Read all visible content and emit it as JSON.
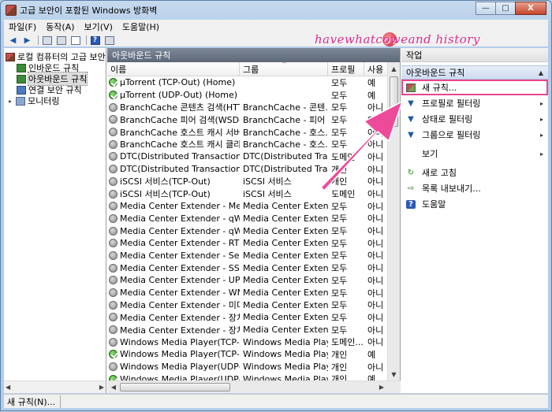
{
  "window": {
    "title": "고급 보안이 포함된 Windows 방화벽",
    "minimize_label": "—",
    "maximize_label": "□",
    "close_label": "X"
  },
  "menu": [
    "파일(F)",
    "동작(A)",
    "보기(V)",
    "도움말(H)"
  ],
  "toolbar": {
    "back_icon": "◀",
    "forward_icon": "▶",
    "help_label": "?"
  },
  "watermark": "havewhatcoweand history",
  "tree": {
    "root": "로컬 컴퓨터의 고급 보안",
    "items": [
      "인바운드 규칙",
      "아웃바운드 규칙",
      "연결 보안 규칙",
      "모니터링"
    ],
    "selected_index": 1,
    "expander": "▸"
  },
  "center": {
    "header": "아웃바운드 규칙",
    "columns": [
      "이름",
      "그룹",
      "프로필",
      "사용"
    ],
    "sort_arrow": "^",
    "rows": [
      {
        "state": "on",
        "name": "µTorrent (TCP-Out) (Home)",
        "group": "",
        "profile": "모두",
        "enabled": "예"
      },
      {
        "state": "on",
        "name": "µTorrent (UDP-Out) (Home)",
        "group": "",
        "profile": "모두",
        "enabled": "예"
      },
      {
        "state": "off",
        "name": "BranchCache 콘텐츠 검색(HTTP...",
        "group": "BranchCache - 콘텐...",
        "profile": "모두",
        "enabled": "아니"
      },
      {
        "state": "off",
        "name": "BranchCache 피어 검색(WSD-O...",
        "group": "BranchCache - 피어 ...",
        "profile": "모두",
        "enabled": "아니"
      },
      {
        "state": "off",
        "name": "BranchCache 호스트 캐시 서버(...",
        "group": "BranchCache - 호스...",
        "profile": "모두",
        "enabled": "아니"
      },
      {
        "state": "off",
        "name": "BranchCache 호스트 캐시 클라...",
        "group": "BranchCache - 호스...",
        "profile": "모두",
        "enabled": "아니"
      },
      {
        "state": "off",
        "name": "DTC(Distributed Transaction C...",
        "group": "DTC(Distributed Tran...",
        "profile": "도메인",
        "enabled": "아니"
      },
      {
        "state": "off",
        "name": "DTC(Distributed Transaction C...",
        "group": "DTC(Distributed Tran...",
        "profile": "개인",
        "enabled": "아니"
      },
      {
        "state": "off",
        "name": "iSCSI 서비스(TCP-Out)",
        "group": "iSCSI 서비스",
        "profile": "개인",
        "enabled": "아니"
      },
      {
        "state": "off",
        "name": "iSCSI 서비스(TCP-Out)",
        "group": "iSCSI 서비스",
        "profile": "도메인",
        "enabled": "아니"
      },
      {
        "state": "off",
        "name": "Media Center Extender - Media...",
        "group": "Media Center Extender",
        "profile": "모두",
        "enabled": "아니"
      },
      {
        "state": "off",
        "name": "Media Center Extender - qWav...",
        "group": "Media Center Extender",
        "profile": "모두",
        "enabled": "아니"
      },
      {
        "state": "off",
        "name": "Media Center Extender - qWav...",
        "group": "Media Center Extender",
        "profile": "모두",
        "enabled": "아니"
      },
      {
        "state": "off",
        "name": "Media Center Extender - RTSP(...",
        "group": "Media Center Extender",
        "profile": "모두",
        "enabled": "아니"
      },
      {
        "state": "off",
        "name": "Media Center Extender - Servic...",
        "group": "Media Center Extender",
        "profile": "모두",
        "enabled": "아니"
      },
      {
        "state": "off",
        "name": "Media Center Extender - SSDP(...",
        "group": "Media Center Extender",
        "profile": "모두",
        "enabled": "아니"
      },
      {
        "state": "off",
        "name": "Media Center Extender - UPnP(...",
        "group": "Media Center Extender",
        "profile": "모두",
        "enabled": "아니"
      },
      {
        "state": "off",
        "name": "Media Center Extender - WMD...",
        "group": "Media Center Extender",
        "profile": "모두",
        "enabled": "아니"
      },
      {
        "state": "off",
        "name": "Media Center Extender - 미디...",
        "group": "Media Center Extender",
        "profile": "모두",
        "enabled": "아니"
      },
      {
        "state": "off",
        "name": "Media Center Extender - 장치 ...",
        "group": "Media Center Extender",
        "profile": "모두",
        "enabled": "아니"
      },
      {
        "state": "off",
        "name": "Media Center Extender - 장치 ...",
        "group": "Media Center Extender",
        "profile": "모두",
        "enabled": "아니"
      },
      {
        "state": "off",
        "name": "Windows Media Player(TCP-Out)",
        "group": "Windows Media Player",
        "profile": "도메인...",
        "enabled": "아니"
      },
      {
        "state": "on",
        "name": "Windows Media Player(TCP-Out)",
        "group": "Windows Media Player",
        "profile": "개인",
        "enabled": "예"
      },
      {
        "state": "off",
        "name": "Windows Media Player(UDP-Ou...",
        "group": "Windows Media Player",
        "profile": "개인",
        "enabled": "아니"
      },
      {
        "state": "on",
        "name": "Windows Media Player(UDP-O...",
        "group": "Windows Media Player",
        "profile": "개인",
        "enabled": "예"
      }
    ]
  },
  "actions": {
    "header": "작업",
    "section": "아웃바운드 규칙",
    "items": [
      {
        "label": "새 규칙...",
        "icon": "new-rule-icon",
        "submenu": false,
        "highlight": true
      },
      {
        "label": "프로필로 필터링",
        "icon": "filter-icon",
        "submenu": true
      },
      {
        "label": "상태로 필터링",
        "icon": "filter-icon",
        "submenu": true
      },
      {
        "label": "그룹으로 필터링",
        "icon": "filter-icon",
        "submenu": true
      },
      {
        "label": "보기",
        "icon": "",
        "submenu": true
      },
      {
        "label": "새로 고침",
        "icon": "refresh-icon",
        "submenu": false
      },
      {
        "label": "목록 내보내기...",
        "icon": "export-icon",
        "submenu": false
      },
      {
        "label": "도움말",
        "icon": "help-icon",
        "submenu": false
      }
    ],
    "submenu_glyph": "▸",
    "section_caret": "▲"
  },
  "status": {
    "text": "새 규칙(N)..."
  },
  "colors": {
    "highlight": "#e8468e",
    "arrow": "#ee4a9a"
  }
}
